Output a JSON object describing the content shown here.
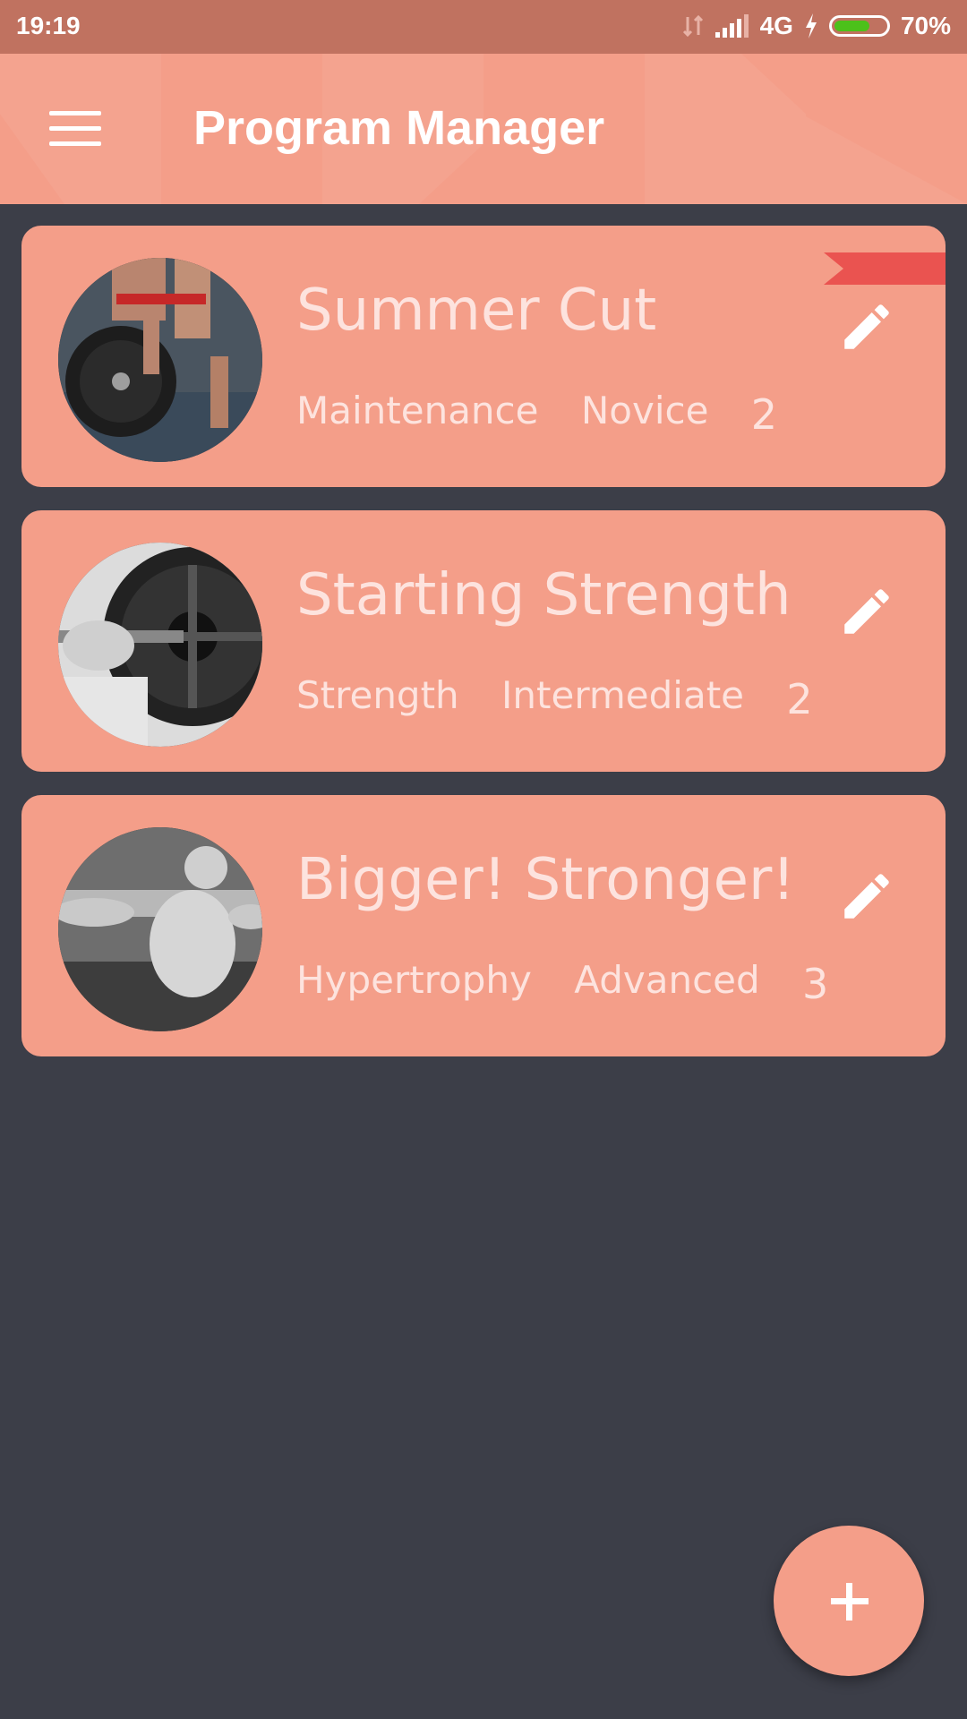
{
  "status_bar": {
    "time": "19:19",
    "network": "4G",
    "battery": "70%",
    "battery_level": 0.7,
    "battery_color": "#4cc11a",
    "icons": [
      "data-transfer-icon",
      "signal-icon",
      "charging-icon",
      "battery-icon"
    ]
  },
  "app_bar": {
    "title": "Program Manager",
    "menu_icon": "hamburger-menu-icon",
    "background": "#f49e89"
  },
  "programs": [
    {
      "name": "Summer Cut",
      "goal": "Maintenance",
      "level": "Novice",
      "count": "2",
      "image": "deadlift-plate-photo",
      "flagged": true
    },
    {
      "name": "Starting Strength",
      "goal": "Strength",
      "level": "Intermediate",
      "count": "2",
      "image": "barbell-plate-photo",
      "flagged": false
    },
    {
      "name": "Bigger! Stronger!",
      "goal": "Hypertrophy",
      "level": "Advanced",
      "count": "3",
      "image": "bodybuilder-pose-photo",
      "flagged": false
    }
  ],
  "fab": {
    "icon": "plus-icon"
  },
  "colors": {
    "background": "#3c3e48",
    "card": "#f49e89",
    "status_bar": "#c07260",
    "ribbon": "#ea5350",
    "card_text": "#fde3de"
  }
}
